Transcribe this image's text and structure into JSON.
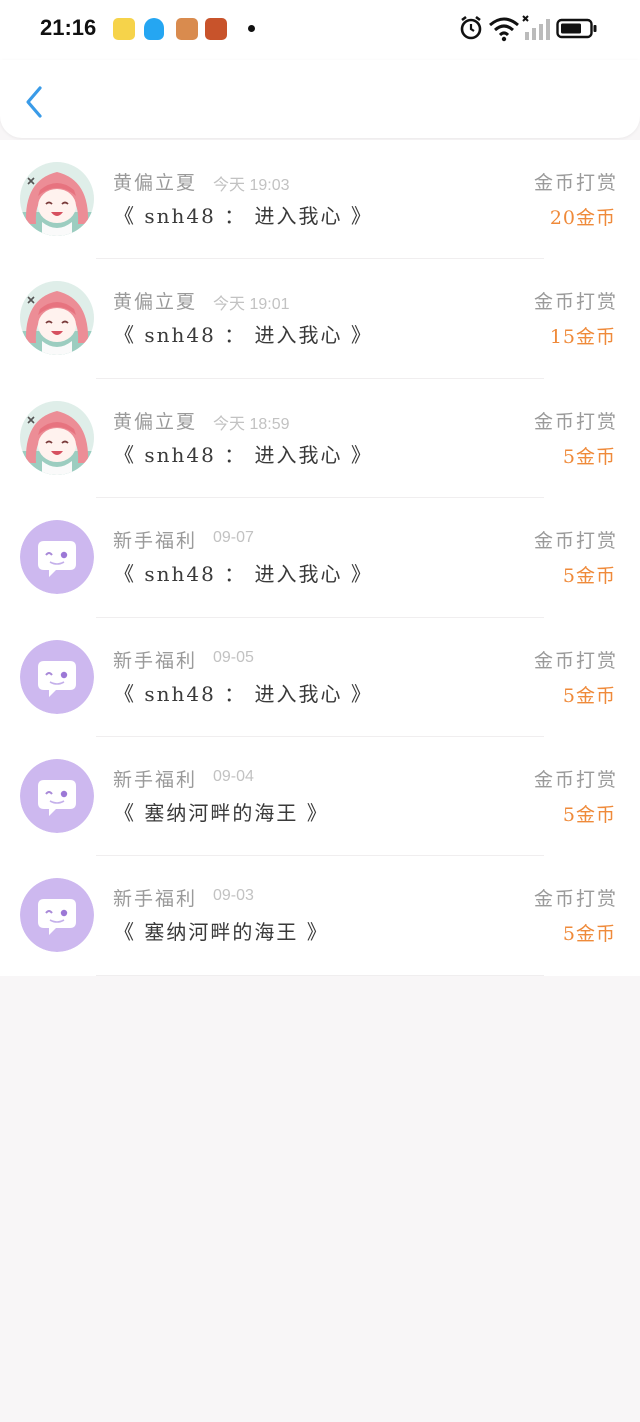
{
  "status_bar": {
    "time": "21:16",
    "notification_icons": [
      "weather-app-icon",
      "qq-penguin-icon",
      "game-app-icon",
      "game-app-icon-2"
    ],
    "system_icons": [
      "alarm-icon",
      "wifi-icon",
      "signal-icon",
      "battery-icon"
    ]
  },
  "header": {
    "back_icon": "chevron-left-icon",
    "accent_color": "#3a9be8"
  },
  "records": [
    {
      "avatar": "anime-girl-avatar",
      "name": "黄偏立夏",
      "time": "今天 19:03",
      "book": "《 snh48 ： 进入我心 》",
      "type": "金币打赏",
      "amount": "20金币"
    },
    {
      "avatar": "anime-girl-avatar",
      "name": "黄偏立夏",
      "time": "今天 19:01",
      "book": "《 snh48 ： 进入我心 》",
      "type": "金币打赏",
      "amount": "15金币"
    },
    {
      "avatar": "anime-girl-avatar",
      "name": "黄偏立夏",
      "time": "今天 18:59",
      "book": "《 snh48 ： 进入我心 》",
      "type": "金币打赏",
      "amount": "5金币"
    },
    {
      "avatar": "chat-bubble-avatar",
      "name": "新手福利",
      "time": "09-07",
      "book": "《 snh48 ： 进入我心 》",
      "type": "金币打赏",
      "amount": "5金币"
    },
    {
      "avatar": "chat-bubble-avatar",
      "name": "新手福利",
      "time": "09-05",
      "book": "《 snh48 ： 进入我心 》",
      "type": "金币打赏",
      "amount": "5金币"
    },
    {
      "avatar": "chat-bubble-avatar",
      "name": "新手福利",
      "time": "09-04",
      "book": "《 塞纳河畔的海王 》",
      "type": "金币打赏",
      "amount": "5金币"
    },
    {
      "avatar": "chat-bubble-avatar",
      "name": "新手福利",
      "time": "09-03",
      "book": "《 塞纳河畔的海王 》",
      "type": "金币打赏",
      "amount": "5金币"
    }
  ],
  "colors": {
    "amount": "#ef8a3a",
    "muted_text": "#9a9a9a",
    "bubble_avatar": "#cdb8ef"
  }
}
